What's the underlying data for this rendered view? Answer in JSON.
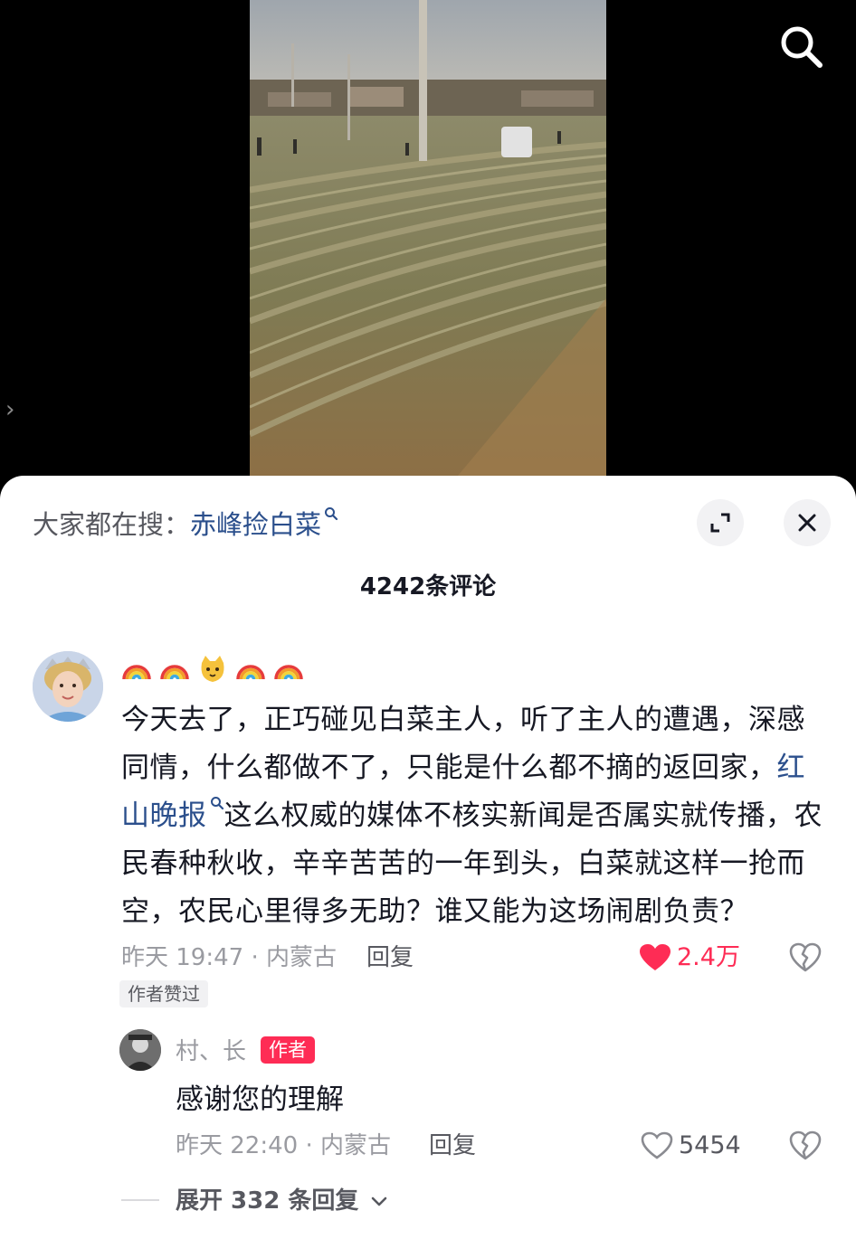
{
  "colors": {
    "accent_link": "#2b4f8c",
    "like_red": "#fe2c55",
    "author_badge": "#fe2c55",
    "muted_text": "#9a9ba1"
  },
  "top_bar": {
    "search_icon": "search-icon",
    "side_arrow": "›"
  },
  "sheet": {
    "hot_search_prefix": "大家都在搜：",
    "hot_search_keyword": "赤峰捡白菜",
    "expand_icon": "expand-icon",
    "close_icon": "close-icon",
    "comment_count_title": "4242条评论"
  },
  "comment": {
    "username_emojis": [
      "rainbow-emoji",
      "rainbow-emoji",
      "cat-emoji",
      "rainbow-emoji",
      "rainbow-emoji"
    ],
    "text_part1": "今天去了，正巧碰见白菜主人，听了主人的遭遇，深感同情，什么都做不了，只能是什么都不摘的返回家，",
    "text_link": "红山晚报",
    "text_part2": "这么权威的媒体不核实新闻是否属实就传播，农民春种秋收，辛辛苦苦的一年到头，白菜就这样一抢而空，农民心里得多无助？谁又能为这场闹剧负责？",
    "time_location": "昨天 19:47 · 内蒙古",
    "reply_label": "回复",
    "like_count": "2.4万",
    "liked": true,
    "author_liked_tag": "作者赞过"
  },
  "reply": {
    "username": "村、长",
    "author_badge": "作者",
    "text": "感谢您的理解",
    "time_location": "昨天 22:40 · 内蒙古",
    "reply_label": "回复",
    "like_count": "5454",
    "liked": false
  },
  "expand": {
    "label": "展开 332 条回复"
  }
}
